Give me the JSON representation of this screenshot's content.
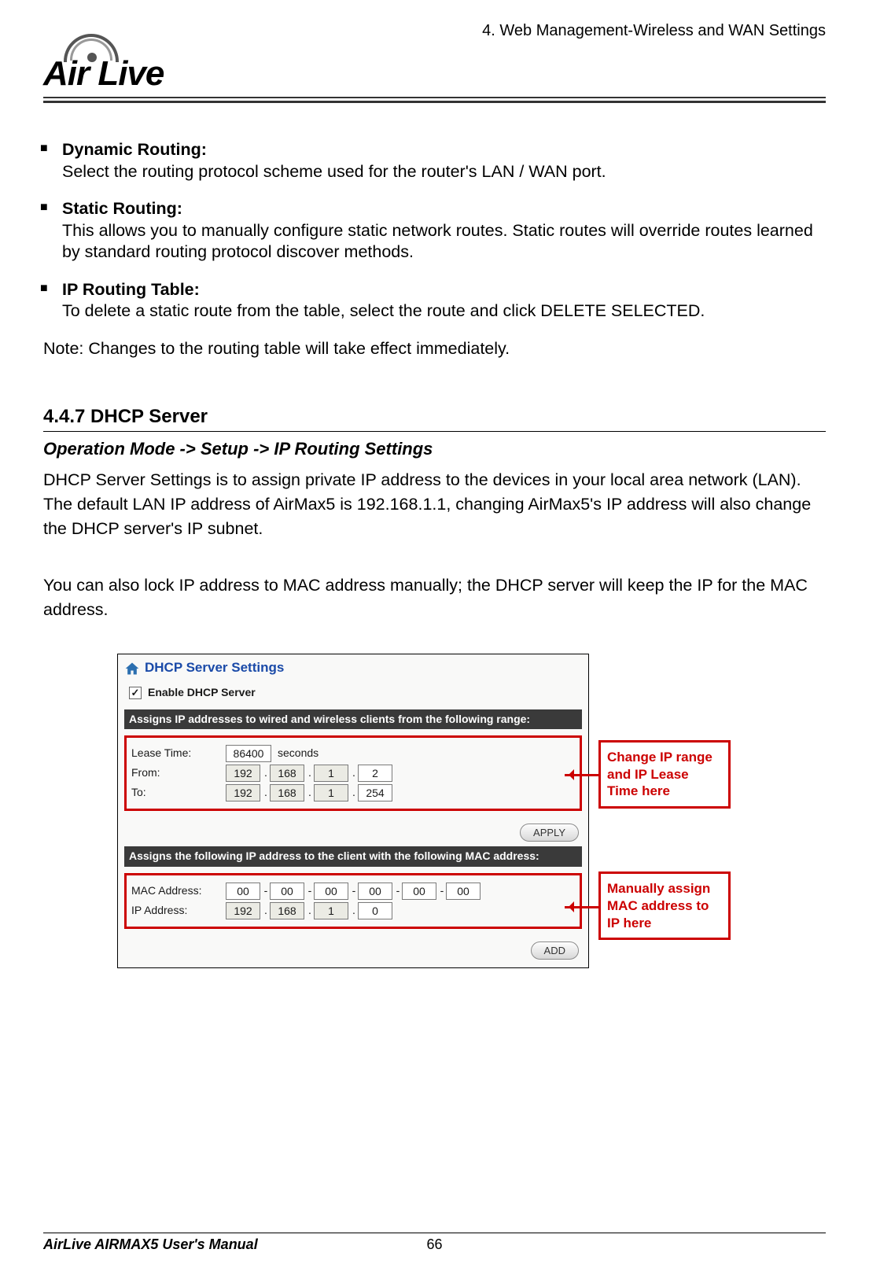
{
  "header_right": "4. Web Management-Wireless and WAN Settings",
  "logo_text": "Air Live",
  "bullets": [
    {
      "title": "Dynamic Routing:",
      "body": "Select the routing protocol scheme used for the router's LAN / WAN port."
    },
    {
      "title": "Static Routing:",
      "body": "This allows you to manually configure static network routes. Static routes will override routes learned by standard routing protocol discover methods."
    },
    {
      "title": "IP Routing Table:",
      "body": "To delete a static route from the table, select the route and click DELETE SELECTED."
    }
  ],
  "note": "Note: Changes to the routing table will take effect immediately.",
  "section_heading": "4.4.7 DHCP Server",
  "section_sub": "Operation Mode -> Setup -> IP Routing Settings",
  "para1": "DHCP Server Settings is to assign private IP address to the devices in your local area network (LAN).   The default LAN IP address of AirMax5 is 192.168.1.1, changing AirMax5's IP address will also change the DHCP server's IP subnet.",
  "para2": "You can also lock IP address to MAC address manually; the DHCP server will keep the IP for the MAC address.",
  "dhcp": {
    "title": "DHCP Server Settings",
    "enable_label": "Enable DHCP Server",
    "enable_checked": "✓",
    "band1": "Assigns IP addresses to wired and wireless clients from the following range:",
    "lease_label": "Lease Time:",
    "lease_value": "86400",
    "lease_unit": "seconds",
    "from_label": "From:",
    "from_ip": [
      "192",
      "168",
      "1",
      "2"
    ],
    "to_label": "To:",
    "to_ip": [
      "192",
      "168",
      "1",
      "254"
    ],
    "apply_btn": "APPLY",
    "band2": "Assigns the following IP address to the client with the following MAC address:",
    "mac_label": "MAC Address:",
    "mac": [
      "00",
      "00",
      "00",
      "00",
      "00",
      "00"
    ],
    "ip_label": "IP Address:",
    "ip": [
      "192",
      "168",
      "1",
      "0"
    ],
    "add_btn": "ADD"
  },
  "callout1": "Change IP range and IP Lease Time here",
  "callout2": "Manually assign MAC address to IP here",
  "footer_left": "AirLive AIRMAX5 User's Manual",
  "footer_page": "66"
}
